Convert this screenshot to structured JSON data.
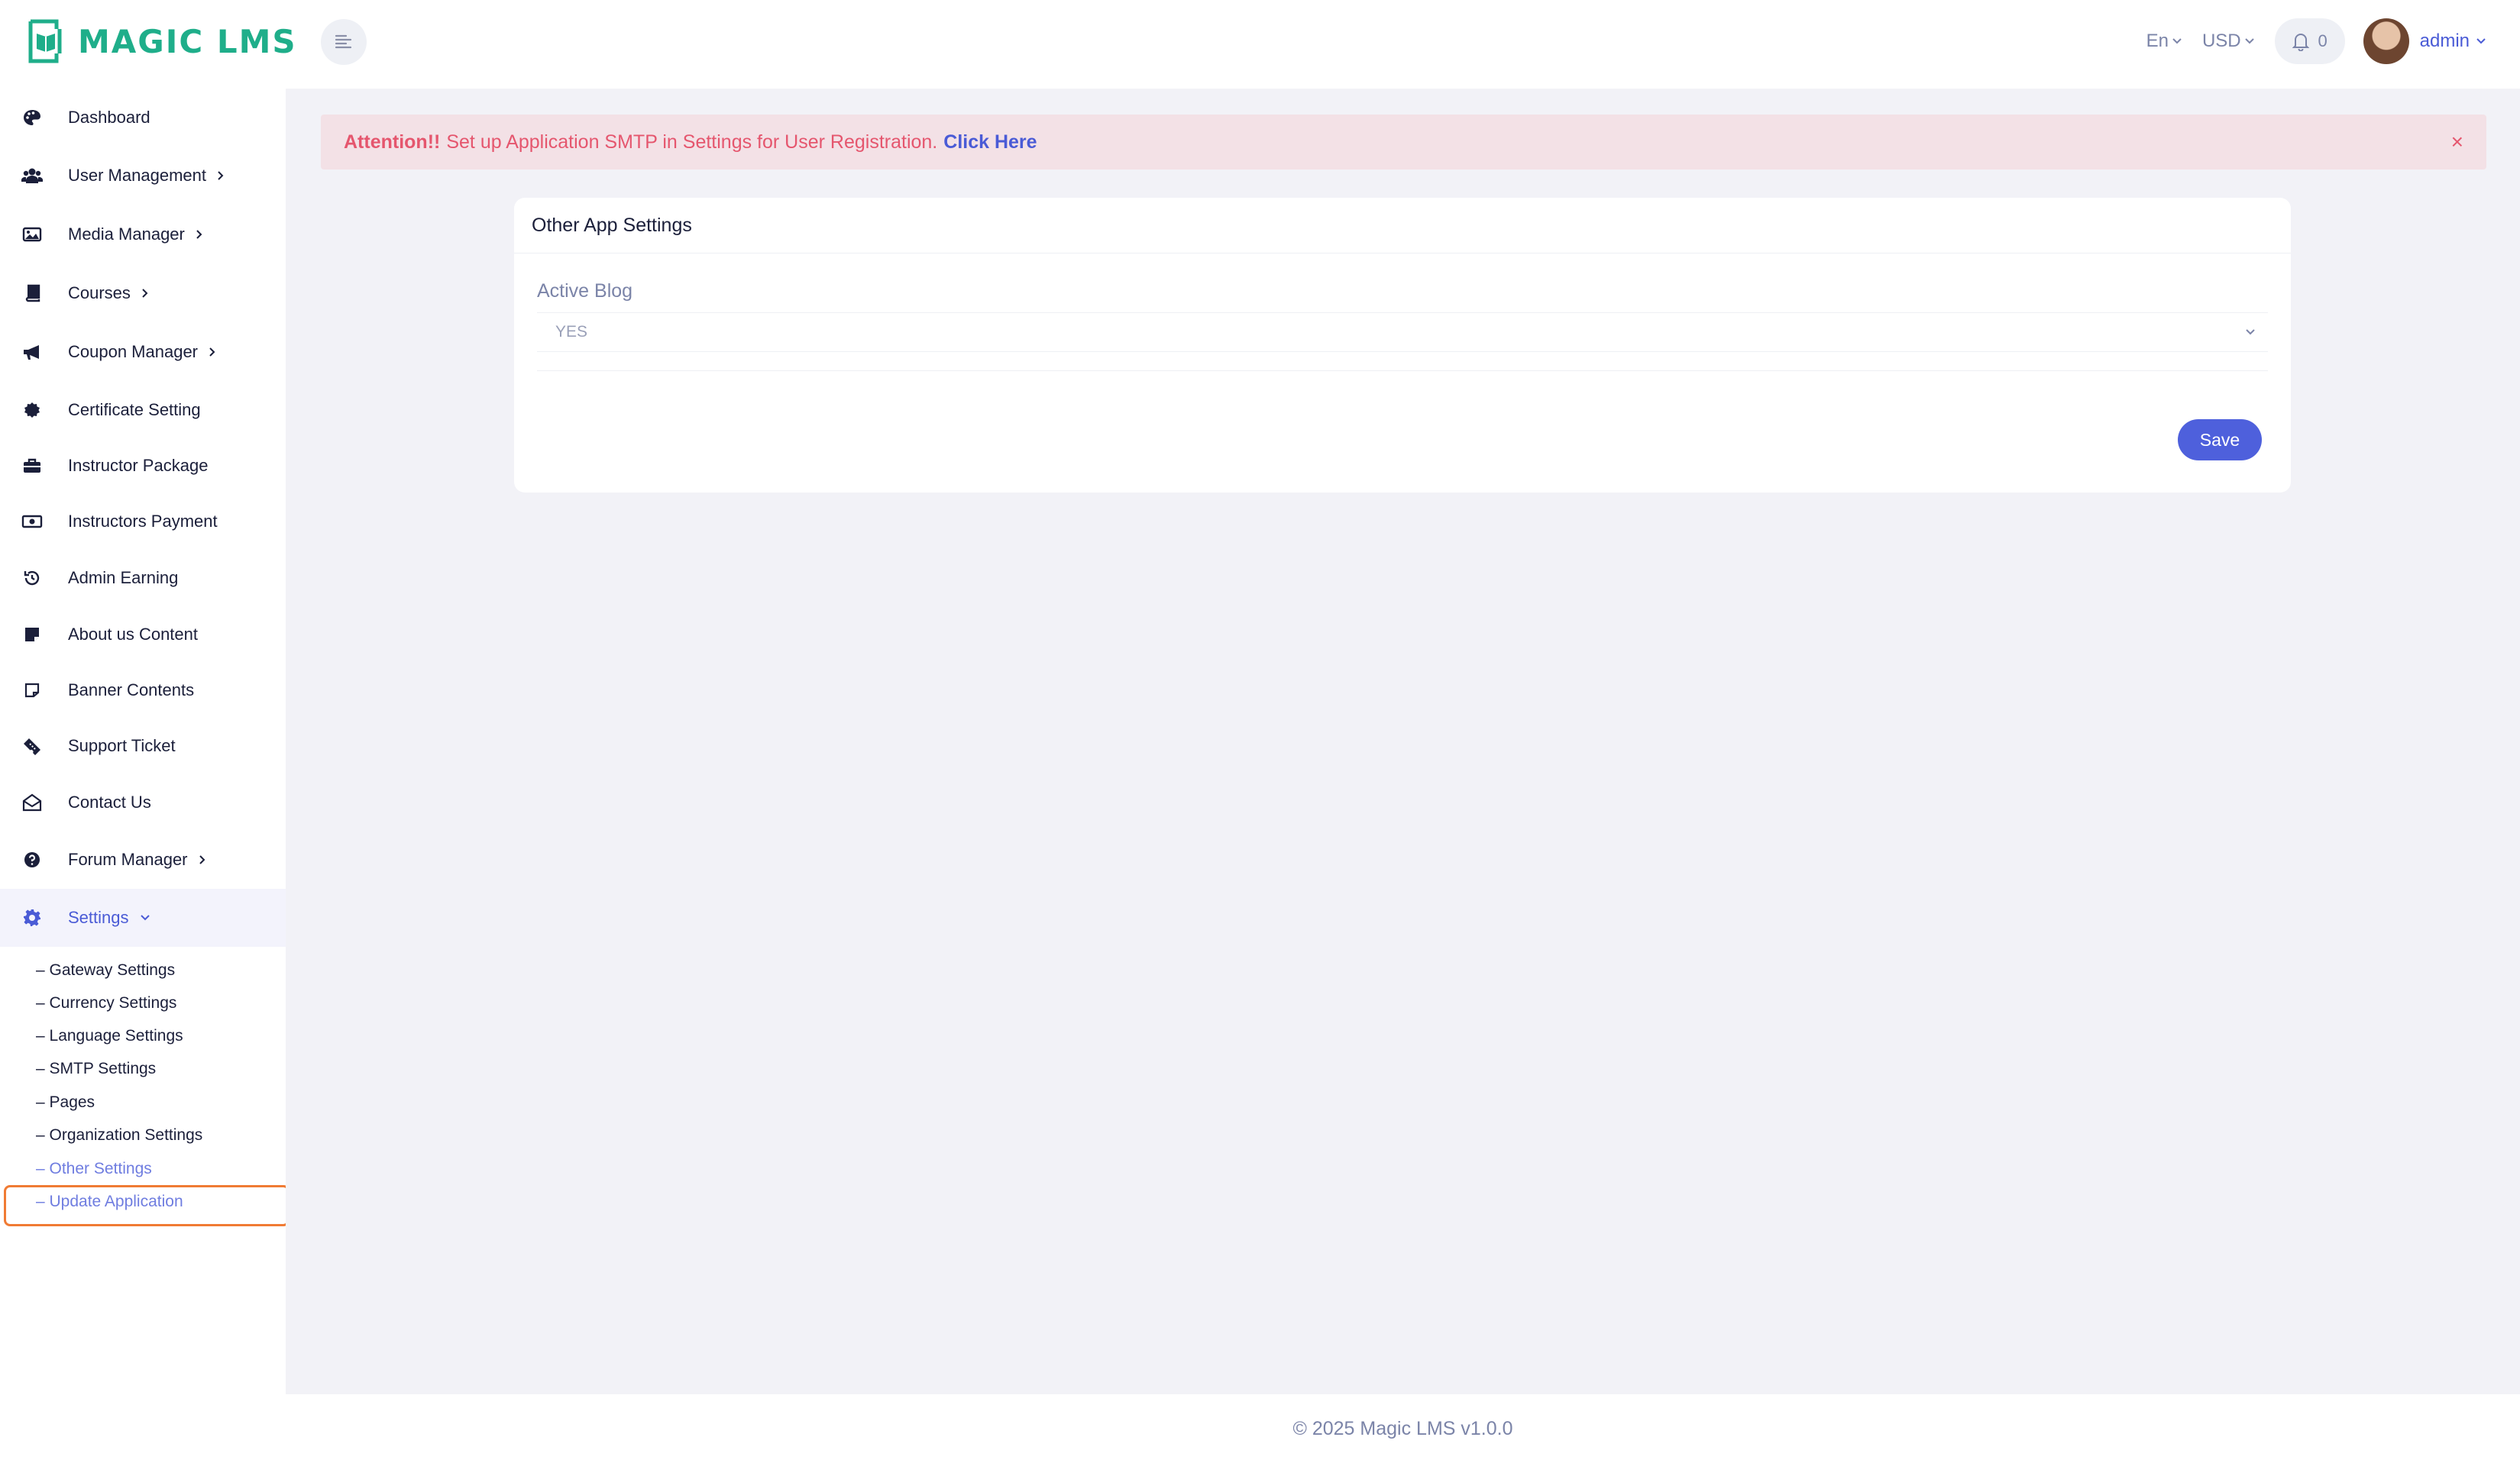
{
  "brand": {
    "name": "MAGIC LMS",
    "color": "#1fae8a"
  },
  "header": {
    "language": "En",
    "currency": "USD",
    "notifications_count": "0",
    "user_name": "admin"
  },
  "sidebar": {
    "items": [
      {
        "label": "Dashboard",
        "icon": "palette-icon"
      },
      {
        "label": "User Management",
        "icon": "users-icon"
      },
      {
        "label": "Media Manager",
        "icon": "image-icon"
      },
      {
        "label": "Courses",
        "icon": "book-icon"
      },
      {
        "label": "Coupon Manager",
        "icon": "megaphone-icon"
      },
      {
        "label": "Certificate Setting",
        "icon": "certificate-icon"
      },
      {
        "label": "Instructor Package",
        "icon": "briefcase-icon"
      },
      {
        "label": "Instructors Payment",
        "icon": "money-icon"
      },
      {
        "label": "Admin Earning",
        "icon": "history-icon"
      },
      {
        "label": "About us Content",
        "icon": "sticky-note-icon"
      },
      {
        "label": "Banner Contents",
        "icon": "note-icon"
      },
      {
        "label": "Support Ticket",
        "icon": "ticket-icon"
      },
      {
        "label": "Contact Us",
        "icon": "envelope-open-icon"
      },
      {
        "label": "Forum Manager",
        "icon": "question-circle-icon"
      },
      {
        "label": "Settings",
        "icon": "gear-icon"
      }
    ],
    "settings_sub": [
      "– Gateway Settings",
      "– Currency Settings",
      "– Language Settings",
      "– SMTP Settings",
      "– Pages",
      "– Organization Settings",
      "– Other Settings",
      "– Update Application"
    ]
  },
  "alert": {
    "strong": "Attention!!",
    "message": "Set up Application SMTP in Settings for User Registration.",
    "link": "Click Here",
    "close": "×"
  },
  "card": {
    "title": "Other App Settings",
    "field_label": "Active Blog",
    "field_value": "YES",
    "save_label": "Save"
  },
  "footer": {
    "text": "© 2025 Magic LMS v1.0.0"
  },
  "colors": {
    "accent": "#4e60dc",
    "alert_bg": "#f3e1e6",
    "alert_text": "#e5566e",
    "highlight": "#f07b34"
  }
}
